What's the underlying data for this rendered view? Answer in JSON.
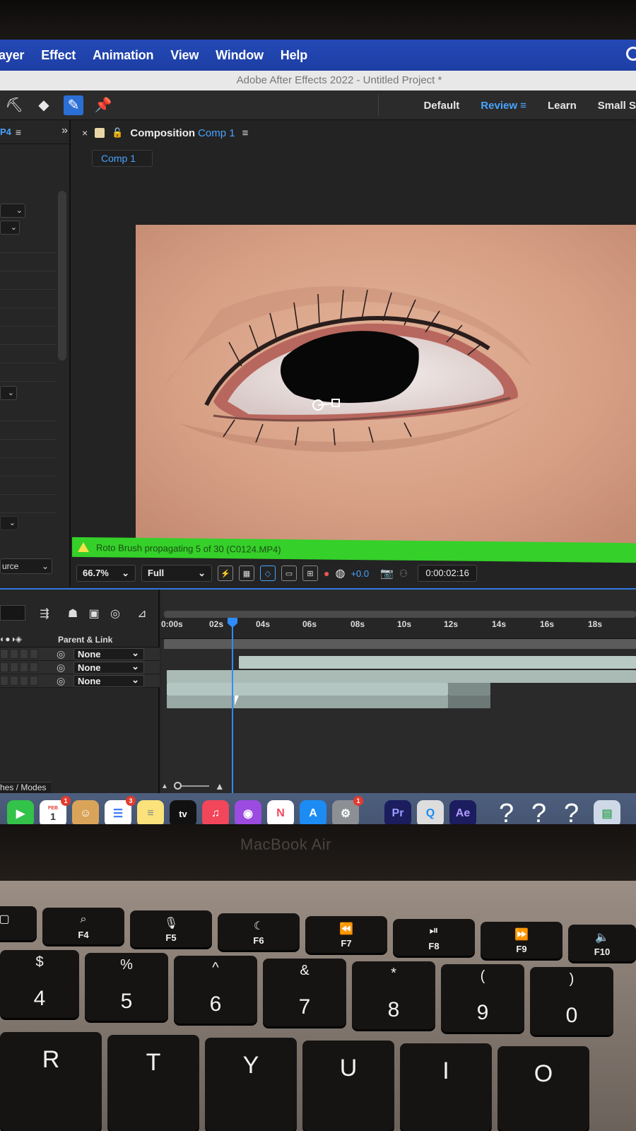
{
  "menubar": {
    "items": [
      "ayer",
      "Effect",
      "Animation",
      "View",
      "Window",
      "Help"
    ],
    "accent": "#2449b6"
  },
  "window": {
    "title": "Adobe After Effects 2022 - Untitled Project *"
  },
  "workspaces": {
    "items": [
      "Default",
      "Review",
      "Learn",
      "Small S"
    ],
    "active": "Review"
  },
  "left_panel": {
    "tab_label": "P4",
    "source_label": "urce"
  },
  "composition": {
    "title_prefix": "Composition",
    "name": "Comp 1",
    "subtab": "Comp 1",
    "status": "Roto Brush propagating 5 of 30 (C0124.MP4)",
    "status_color": "#35d02a",
    "zoom": "66.7%",
    "resolution": "Full",
    "exposure": "+0.0",
    "timecode": "0:00:02:16"
  },
  "timeline": {
    "parent_header": "Parent & Link",
    "layers": [
      {
        "parent": "None"
      },
      {
        "parent": "None"
      },
      {
        "parent": "None"
      }
    ],
    "ticks": [
      "0:00s",
      "02s",
      "04s",
      "06s",
      "08s",
      "10s",
      "12s",
      "14s",
      "16s",
      "18s"
    ],
    "switches_label": "hes / Modes"
  },
  "dock": {
    "calendar_month": "FEB",
    "calendar_day": "1",
    "tv_label": "tv",
    "premiere_label": "Pr",
    "after_effects_label": "Ae",
    "badges": {
      "calendar": "1",
      "reminders": "3",
      "settings": "1"
    },
    "unknown_glyph": "?"
  },
  "laptop": {
    "model": "MacBook Air",
    "fn_keys": [
      "F4",
      "F5",
      "F6",
      "F7",
      "F8",
      "F9",
      "F10"
    ],
    "number_keys": [
      {
        "sym": "$",
        "num": "4"
      },
      {
        "sym": "%",
        "num": "5"
      },
      {
        "sym": "^",
        "num": "6"
      },
      {
        "sym": "&",
        "num": "7"
      },
      {
        "sym": "*",
        "num": "8"
      },
      {
        "sym": "(",
        "num": "9"
      },
      {
        "sym": ")",
        "num": "0"
      }
    ],
    "letter_keys": [
      "R",
      "T",
      "Y",
      "U",
      "I",
      "O"
    ]
  }
}
